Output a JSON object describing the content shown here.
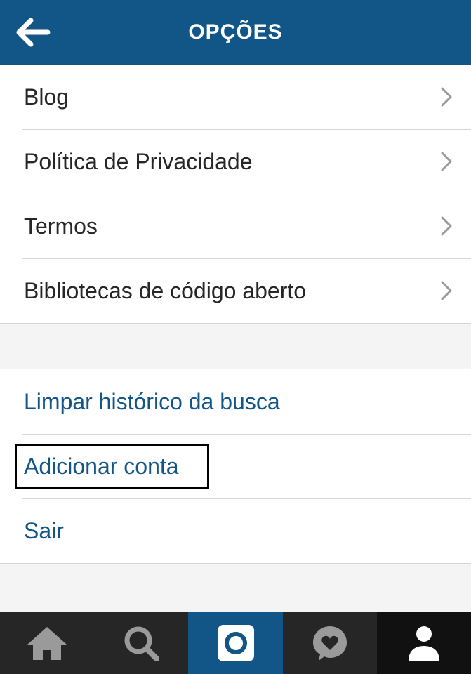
{
  "header": {
    "title": "OPÇÕES",
    "back_icon": "back-arrow-icon",
    "background": "#125688"
  },
  "info_list": {
    "items": [
      {
        "label": "Blog",
        "icon": "chevron-right-icon"
      },
      {
        "label": "Política de Privacidade",
        "icon": "chevron-right-icon"
      },
      {
        "label": "Termos",
        "icon": "chevron-right-icon"
      },
      {
        "label": "Bibliotecas de código aberto",
        "icon": "chevron-right-icon"
      }
    ]
  },
  "actions_list": {
    "items": [
      {
        "label": "Limpar histórico da busca"
      },
      {
        "label": "Adicionar conta",
        "highlighted": true
      },
      {
        "label": "Sair"
      }
    ],
    "link_color": "#125688"
  },
  "tabbar": {
    "tabs": [
      {
        "icon": "home-icon"
      },
      {
        "icon": "search-icon"
      },
      {
        "icon": "camera-icon",
        "active": true
      },
      {
        "icon": "activity-heart-icon"
      },
      {
        "icon": "profile-icon"
      }
    ]
  }
}
